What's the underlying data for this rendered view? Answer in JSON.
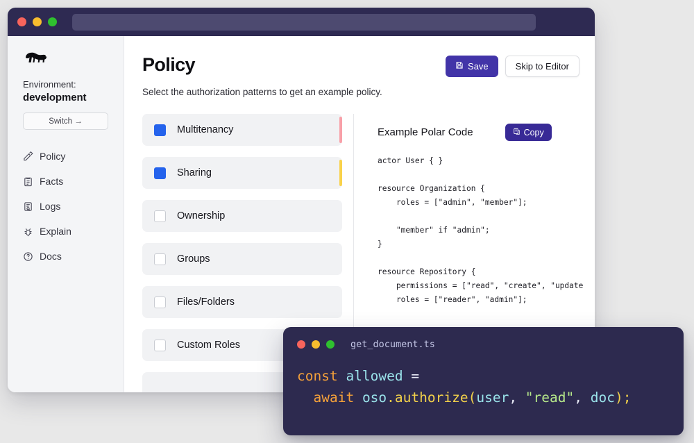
{
  "window": {
    "titlebar": {
      "dots": [
        "close-red",
        "minimize-yellow",
        "maximize-green"
      ],
      "address_value": "",
      "address_placeholder": ""
    }
  },
  "sidebar": {
    "logo_icon": "bear-logo-icon",
    "environment_label": "Environment:",
    "environment_value": "development",
    "switch_label": "Switch →",
    "items": [
      {
        "label": "Policy",
        "icon": "edit-document-icon"
      },
      {
        "label": "Facts",
        "icon": "clipboard-icon"
      },
      {
        "label": "Logs",
        "icon": "document-search-icon"
      },
      {
        "label": "Explain",
        "icon": "bug-icon"
      },
      {
        "label": "Docs",
        "icon": "question-circle-icon"
      }
    ]
  },
  "main": {
    "title": "Policy",
    "subtitle": "Select the authorization patterns to get an example policy.",
    "save_label": "Save",
    "save_icon": "save-disk-icon",
    "skip_label": "Skip to Editor",
    "accent_color": "#4234a8"
  },
  "patterns": [
    {
      "label": "Multitenancy",
      "checked": true,
      "accent": "#f8a0a8"
    },
    {
      "label": "Sharing",
      "checked": true,
      "accent": "#f9d24a"
    },
    {
      "label": "Ownership",
      "checked": false,
      "accent": ""
    },
    {
      "label": "Groups",
      "checked": false,
      "accent": ""
    },
    {
      "label": "Files/Folders",
      "checked": false,
      "accent": ""
    },
    {
      "label": "Custom Roles",
      "checked": false,
      "accent": ""
    },
    {
      "label": "",
      "checked": false,
      "accent": ""
    }
  ],
  "polar": {
    "title": "Example Polar Code",
    "copy_label": "Copy",
    "copy_icon": "clipboard-copy-icon",
    "code": "actor User { }\n\nresource Organization {\n    roles = [\"admin\", \"member\"];\n\n    \"member\" if \"admin\";\n}\n\nresource Repository {\n    permissions = [\"read\", \"create\", \"update\n    roles = [\"reader\", \"admin\"];"
  },
  "code_card": {
    "filename": "get_document.ts",
    "dots": [
      "close-red",
      "minimize-yellow",
      "maximize-green"
    ],
    "line1": {
      "keyword": "const",
      "variable": "allowed",
      "operator": "="
    },
    "line2": {
      "keyword": "await",
      "object": "oso",
      "dot": ".",
      "fn": "authorize",
      "open": "(",
      "arg1": "user",
      "comma1": ", ",
      "arg2": "\"read\"",
      "comma2": ", ",
      "arg3": "doc",
      "close": ");"
    },
    "colors": {
      "keyword": "#f5a13a",
      "variable": "#9ae3ea",
      "function": "#f2d14a",
      "string": "#b6e88a",
      "punct": "#e6e8f5",
      "background": "#2d2a4f"
    }
  }
}
